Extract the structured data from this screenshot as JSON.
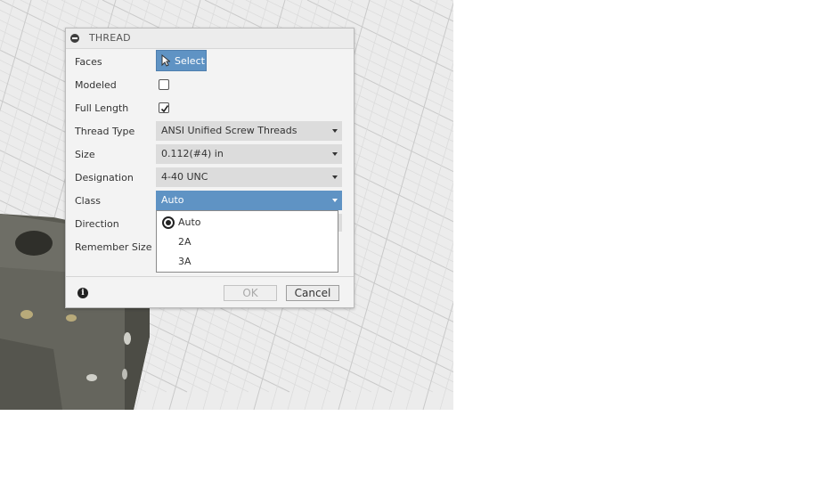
{
  "dialog": {
    "title": "THREAD",
    "rows": {
      "faces": {
        "label": "Faces",
        "button_label": "Select"
      },
      "modeled": {
        "label": "Modeled",
        "checked": false
      },
      "full_length": {
        "label": "Full Length",
        "checked": true
      },
      "thread_type": {
        "label": "Thread Type",
        "value": "ANSI Unified Screw Threads"
      },
      "size": {
        "label": "Size",
        "value": "0.112(#4) in"
      },
      "designation": {
        "label": "Designation",
        "value": "4-40 UNC"
      },
      "class": {
        "label": "Class",
        "value": "Auto"
      },
      "direction": {
        "label": "Direction"
      },
      "remember_size": {
        "label": "Remember Size"
      }
    },
    "class_options": [
      {
        "label": "Auto",
        "selected": true
      },
      {
        "label": "2A",
        "selected": false
      },
      {
        "label": "3A",
        "selected": false
      }
    ],
    "footer": {
      "ok_label": "OK",
      "cancel_label": "Cancel",
      "ok_enabled": false
    }
  },
  "icons": {
    "collapse": "collapse-icon",
    "cursor": "cursor-arrow-icon",
    "checkmark": "checkmark-icon",
    "dropdown": "dropdown-arrow-icon",
    "radio": "radio-selected-icon",
    "info": "info-icon"
  },
  "colors": {
    "accent": "#5f93c4",
    "dialog_bg": "#f3f3f3",
    "dropdown_bg": "#dcdcdc",
    "model": "#6b6b62",
    "grid_bg": "#ececec"
  }
}
